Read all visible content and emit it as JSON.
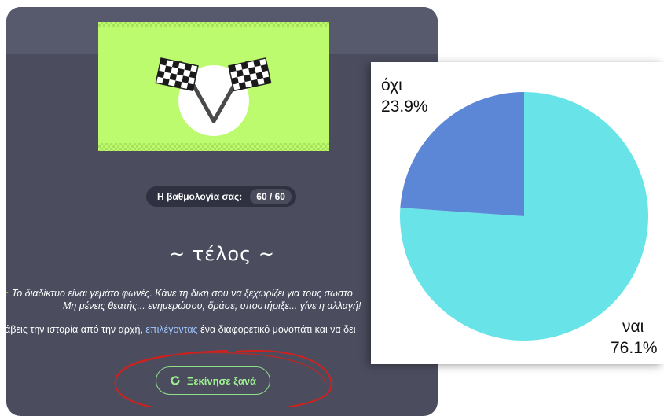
{
  "quiz": {
    "score_label": "Η βαθμολογία σας:",
    "score_value": "60 / 60",
    "end_title": "~ τέλος ~",
    "message_line1": "Το διαδίκτυο είναι γεμάτο φωνές. Κάνε τη δική σου να ξεχωρίζει για τους σωστο",
    "message_line2": "Μη μένεις θεατής... ενημερώσου, δράσε, υποστήριξε... γίνε η αλλαγή!",
    "message_line3_a": "λάβεις την ιστορία από την αρχή, ",
    "message_line3_link": "επιλέγοντας",
    "message_line3_b": " ένα διαφορετικό μονοπάτι και να δει",
    "restart_label": "Ξεκίνησε ξανά"
  },
  "colors": {
    "panel_bg": "#4b4d5f",
    "banner_bg": "#bcfb6d",
    "accent_green": "#9ff08f",
    "annotation_red": "#d0211c",
    "pie_yes": "#68e3e8",
    "pie_no": "#5c86d6"
  },
  "icons": {
    "banner": "checkered-flags-icon",
    "restart": "refresh-icon",
    "star": "star-icon"
  },
  "chart_data": {
    "type": "pie",
    "slices": [
      {
        "label": "ναι",
        "value": 76.1,
        "display": "76.1%",
        "color": "#68e3e8"
      },
      {
        "label": "όχι",
        "value": 23.9,
        "display": "23.9%",
        "color": "#5c86d6"
      }
    ],
    "start_angle_deg": 0,
    "direction": "clockwise"
  }
}
